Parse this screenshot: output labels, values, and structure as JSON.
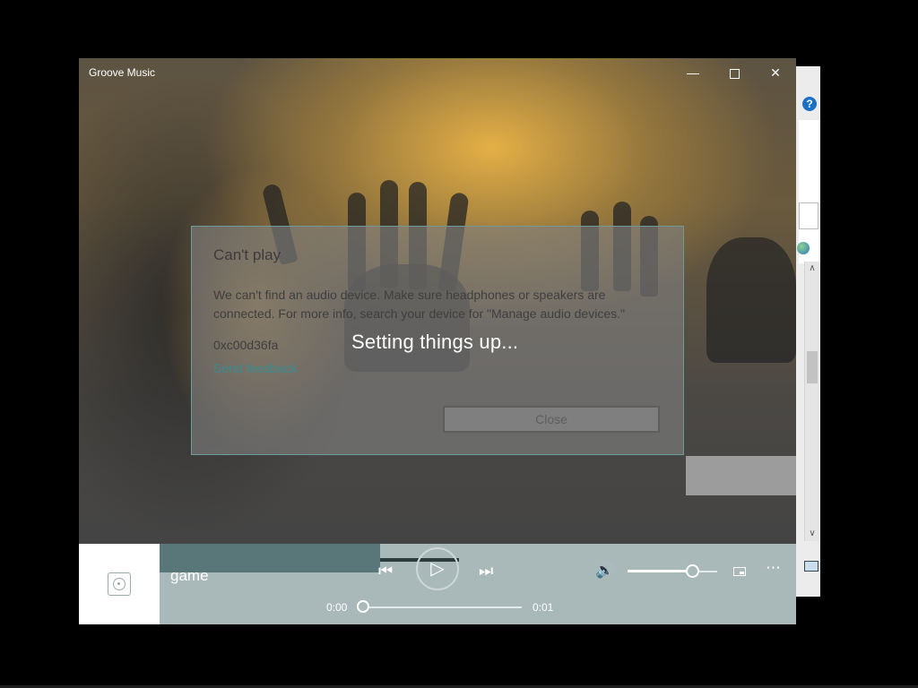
{
  "window": {
    "title": "Groove Music",
    "controls": {
      "minimize": "—",
      "close": "✕"
    }
  },
  "dialog": {
    "title": "Can't play",
    "message": "We can't find an audio device. Make sure headphones or speakers are connected. For more info, search your device for \"Manage audio devices.\"",
    "error_code": "0xc00d36fa",
    "feedback_link": "Send feedback",
    "close_button": "Close"
  },
  "status": {
    "setup_text": "Setting things up..."
  },
  "player": {
    "track_title": "game",
    "time_elapsed": "0:00",
    "time_total": "0:01",
    "volume_level": 0.72,
    "progress": 0.0,
    "icons": {
      "previous": "⏮",
      "play": "▷",
      "next": "⏭",
      "volume": "🔊",
      "more": "⋯"
    }
  },
  "background_window": {
    "help_icon": "?",
    "scroll_up": "∧",
    "scroll_down": "∨"
  },
  "colors": {
    "player_bar": "#a9b9ba",
    "loading_bar": "#597779",
    "link": "#3b8c91"
  }
}
